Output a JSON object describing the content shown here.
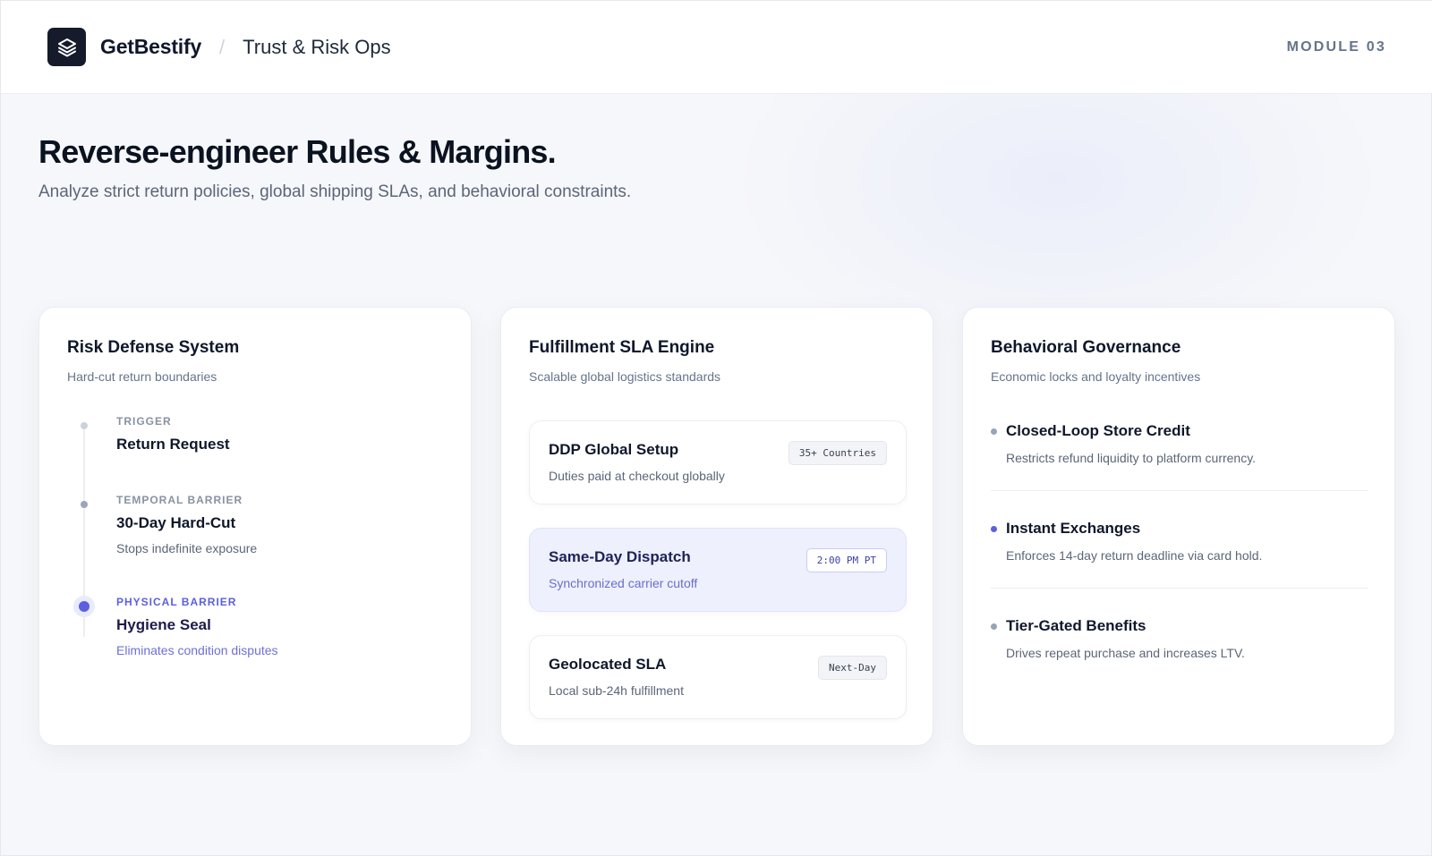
{
  "header": {
    "brand": "GetBestify",
    "separator": "/",
    "breadcrumb": "Trust & Risk Ops",
    "module": "MODULE 03"
  },
  "hero": {
    "title": "Reverse-engineer Rules & Margins.",
    "subtitle": "Analyze strict return policies, global shipping SLAs, and behavioral constraints."
  },
  "cards": {
    "risk": {
      "title": "Risk Defense System",
      "subtitle": "Hard-cut return boundaries",
      "steps": [
        {
          "label": "TRIGGER",
          "title": "Return Request",
          "desc": ""
        },
        {
          "label": "TEMPORAL BARRIER",
          "title": "30-Day Hard-Cut",
          "desc": "Stops indefinite exposure"
        },
        {
          "label": "PHYSICAL BARRIER",
          "title": "Hygiene Seal",
          "desc": "Eliminates condition disputes"
        }
      ]
    },
    "sla": {
      "title": "Fulfillment SLA Engine",
      "subtitle": "Scalable global logistics standards",
      "items": [
        {
          "title": "DDP Global Setup",
          "desc": "Duties paid at checkout globally",
          "badge": "35+ Countries"
        },
        {
          "title": "Same-Day Dispatch",
          "desc": "Synchronized carrier cutoff",
          "badge": "2:00 PM PT"
        },
        {
          "title": "Geolocated SLA",
          "desc": "Local sub-24h fulfillment",
          "badge": "Next-Day"
        }
      ]
    },
    "governance": {
      "title": "Behavioral Governance",
      "subtitle": "Economic locks and loyalty incentives",
      "items": [
        {
          "title": "Closed-Loop Store Credit",
          "desc": "Restricts refund liquidity to platform currency."
        },
        {
          "title": "Instant Exchanges",
          "desc": "Enforces 14-day return deadline via card hold."
        },
        {
          "title": "Tier-Gated Benefits",
          "desc": "Drives repeat purchase and increases LTV."
        }
      ]
    }
  },
  "colors": {
    "accent": "#5b5fe0",
    "dark": "#151b2b",
    "background": "#f6f7fa"
  },
  "icons": {
    "logo": "layers-icon"
  }
}
